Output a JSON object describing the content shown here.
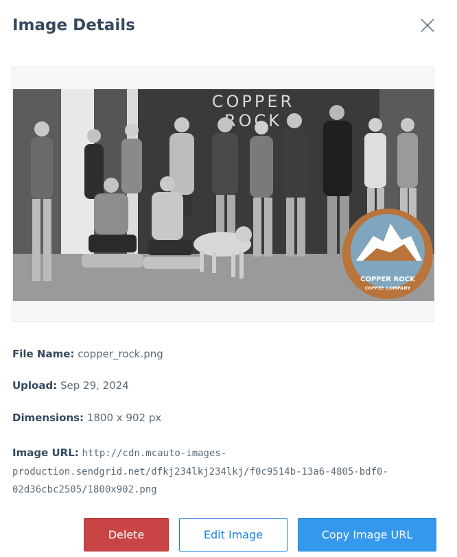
{
  "dialog": {
    "title": "Image Details"
  },
  "image": {
    "sign_line1": "COPPER",
    "sign_line2": "ROCK",
    "logo_line1": "COPPER ROCK",
    "logo_line2": "COFFEE COMPANY"
  },
  "details": {
    "file_name_label": "File Name:",
    "file_name_value": "copper_rock.png",
    "upload_label": "Upload:",
    "upload_value": "Sep 29, 2024",
    "dimensions_label": "Dimensions:",
    "dimensions_value": "1800 x 902 px",
    "url_label": "Image URL:",
    "url_line1": "http://cdn.mcauto-images-",
    "url_line2": "production.sendgrid.net/dfkj234lkj234lkj/f0c9514b-13a6-4805-bdf0-",
    "url_line3": "02d36cbc2505/1800x902.png"
  },
  "actions": {
    "delete_label": "Delete",
    "edit_label": "Edit Image",
    "copy_label": "Copy Image URL"
  },
  "colors": {
    "delete": "#c94545",
    "edit_border": "#1a82e2",
    "copy": "#3498ec",
    "logo_orange": "#b8743a",
    "logo_blue": "#7fa6be"
  }
}
